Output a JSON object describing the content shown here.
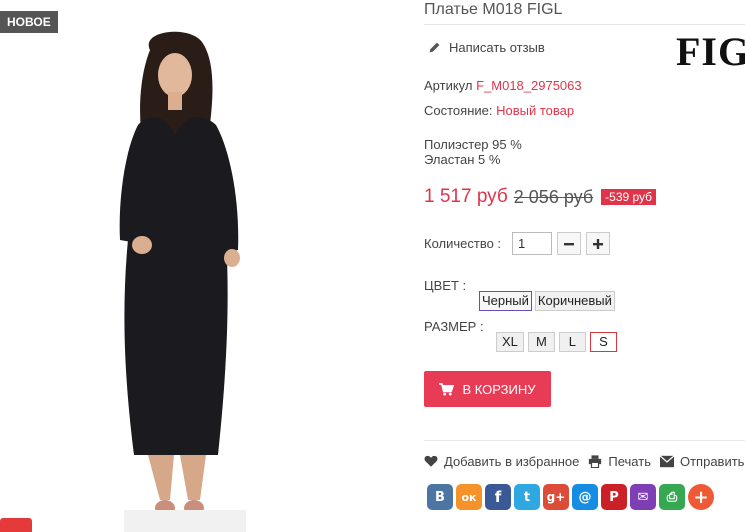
{
  "badge": {
    "new_label": "НОВОЕ"
  },
  "product": {
    "title": "Платье M018 FIGL",
    "brand_logo": "FIGL",
    "write_review": "Написать отзыв",
    "sku_label": "Артикул",
    "sku_value": "F_M018_2975063",
    "condition_label": "Состояние:",
    "condition_value": "Новый товар",
    "composition": [
      "Полиэстер 95 %",
      "Эластан 5 %"
    ]
  },
  "price": {
    "current": "1 517 руб",
    "old": "2 056 руб",
    "discount": "-539 руб"
  },
  "quantity": {
    "label": "Количество :",
    "value": "1"
  },
  "color": {
    "label": "ЦВЕТ :",
    "options": [
      "Черный",
      "Коричневый"
    ],
    "selected": "Черный"
  },
  "size": {
    "label": "РАЗМЕР :",
    "options": [
      "XL",
      "M",
      "L",
      "S"
    ],
    "selected": "S"
  },
  "cart": {
    "label": "В КОРЗИНУ"
  },
  "actions": {
    "wishlist": "Добавить в избранное",
    "print": "Печать",
    "send": "Отправить д"
  },
  "share": [
    {
      "name": "vk",
      "glyph": "В",
      "color": "#4c75a3"
    },
    {
      "name": "odnoklassniki",
      "glyph": "ок",
      "color": "#f5922a"
    },
    {
      "name": "facebook",
      "glyph": "f",
      "color": "#3b5998"
    },
    {
      "name": "twitter",
      "glyph": "t",
      "color": "#2fa7e0"
    },
    {
      "name": "google-plus",
      "glyph": "g+",
      "color": "#dd4b39"
    },
    {
      "name": "mail-ru",
      "glyph": "@",
      "color": "#168de2"
    },
    {
      "name": "pinterest",
      "glyph": "P",
      "color": "#cb2027"
    },
    {
      "name": "email",
      "glyph": "✉",
      "color": "#7d3fb3"
    },
    {
      "name": "print",
      "glyph": "⎙",
      "color": "#36a852"
    },
    {
      "name": "more",
      "glyph": "+",
      "color": "#ef5a36"
    }
  ],
  "colors": {
    "accent": "#e0344a",
    "button": "#e83c56",
    "badge": "#555555"
  }
}
